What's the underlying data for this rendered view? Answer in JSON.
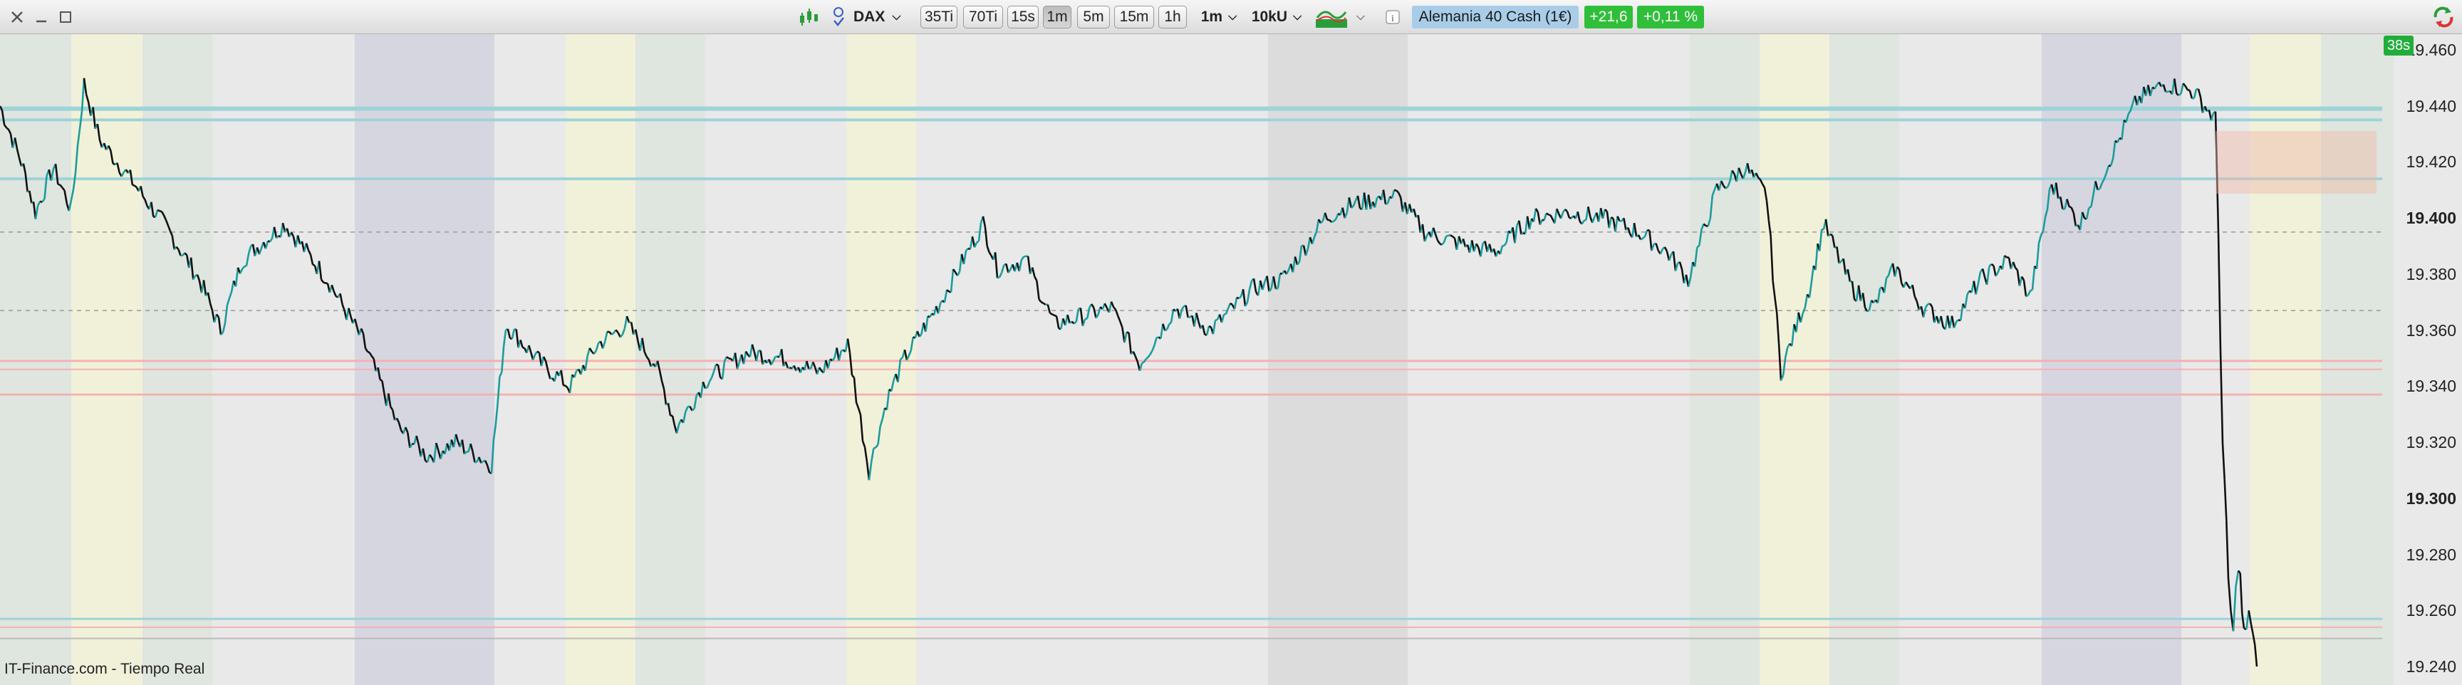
{
  "window": {
    "close_icon": "close-icon",
    "minimize_icon": "minimize-icon",
    "maximize_icon": "maximize-icon"
  },
  "toolbar": {
    "symbol": "DAX",
    "tick_buttons": [
      "35Ti",
      "70Ti"
    ],
    "time_buttons": [
      "15s",
      "1m",
      "5m",
      "15m",
      "1h"
    ],
    "active_time": "1m",
    "interval_dropdown": "1m",
    "volume_dropdown": "10kU",
    "instrument": "Alemania 40 Cash (1€)",
    "change_points": "+21,6",
    "change_percent": "+0,11 %",
    "colors": {
      "instrument_bg": "#a9cde8",
      "change_bg": "#2fbf3a"
    }
  },
  "chart": {
    "timer": "38s",
    "footer": "IT-Finance.com - Tiempo Real",
    "y_labels": [
      {
        "text": "19.460",
        "bold": false,
        "value": 19460
      },
      {
        "text": "19.440",
        "bold": false,
        "value": 19440
      },
      {
        "text": "19.420",
        "bold": false,
        "value": 19420
      },
      {
        "text": "19.400",
        "bold": true,
        "value": 19400
      },
      {
        "text": "19.380",
        "bold": false,
        "value": 19380
      },
      {
        "text": "19.360",
        "bold": false,
        "value": 19360
      },
      {
        "text": "19.340",
        "bold": false,
        "value": 19340
      },
      {
        "text": "19.320",
        "bold": false,
        "value": 19320
      },
      {
        "text": "19.300",
        "bold": true,
        "value": 19300
      },
      {
        "text": "19.280",
        "bold": false,
        "value": 19280
      },
      {
        "text": "19.260",
        "bold": false,
        "value": 19260
      },
      {
        "text": "19.240",
        "bold": false,
        "value": 19240
      }
    ],
    "colors": {
      "line_up": "#1b9c9c",
      "line_down": "#111111"
    }
  }
}
